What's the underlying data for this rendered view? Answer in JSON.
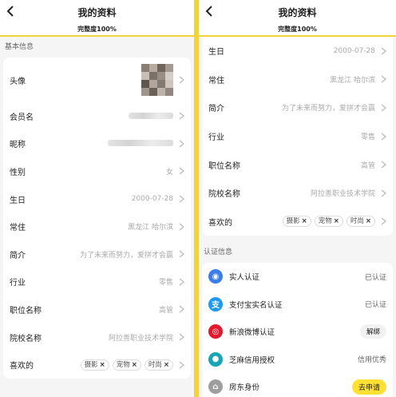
{
  "header": {
    "title": "我的资料",
    "completeness": "完整度100%"
  },
  "left": {
    "section_title": "基本信息",
    "rows": [
      {
        "label": "头像",
        "type": "avatar"
      },
      {
        "label": "会员名",
        "type": "blurred"
      },
      {
        "label": "昵称",
        "type": "blurred"
      },
      {
        "label": "性别",
        "value": "女"
      },
      {
        "label": "生日",
        "value": "2000-07-28"
      },
      {
        "label": "常住",
        "value": "黑龙江 哈尔滨"
      },
      {
        "label": "简介",
        "value": "为了未来而努力，爱拼才会赢"
      },
      {
        "label": "行业",
        "value": "零售"
      },
      {
        "label": "职位名称",
        "value": "高管"
      },
      {
        "label": "院校名称",
        "value": "阿拉善职业技术学院"
      },
      {
        "label": "喜欢的",
        "tags": [
          "摄影",
          "宠物",
          "时尚"
        ]
      }
    ]
  },
  "right": {
    "rows": [
      {
        "label": "生日",
        "value": "2000-07-28"
      },
      {
        "label": "常住",
        "value": "黑龙江 哈尔滨"
      },
      {
        "label": "简介",
        "value": "为了未来而努力，爱拼才会赢"
      },
      {
        "label": "行业",
        "value": "零售"
      },
      {
        "label": "职位名称",
        "value": "高管"
      },
      {
        "label": "院校名称",
        "value": "阿拉善职业技术学院"
      },
      {
        "label": "喜欢的",
        "tags": [
          "摄影",
          "宠物",
          "时尚"
        ]
      }
    ],
    "cert_title": "认证信息",
    "certs": [
      {
        "name": "实人认证",
        "status": "已认证",
        "icon": "person-badge-icon",
        "color": "#3b7de9"
      },
      {
        "name": "支付宝实名认证",
        "status": "已认证",
        "icon": "alipay-icon",
        "color": "#1e9af0"
      },
      {
        "name": "新浪微博认证",
        "status": "解绑",
        "icon": "weibo-icon",
        "color": "#e6162d",
        "style": "pill"
      },
      {
        "name": "芝麻信用授权",
        "status": "信用优秀",
        "icon": "sesame-icon",
        "color": "#16a6b6"
      },
      {
        "name": "房东身份",
        "status": "去申请",
        "icon": "house-icon",
        "color": "#9e9e9e",
        "style": "apply"
      }
    ]
  },
  "colors": {
    "accent": "#f3d33a",
    "apply": "#ffe033"
  },
  "icons": {
    "back": "back-arrow-icon",
    "chevron": "chevron-right-icon"
  }
}
